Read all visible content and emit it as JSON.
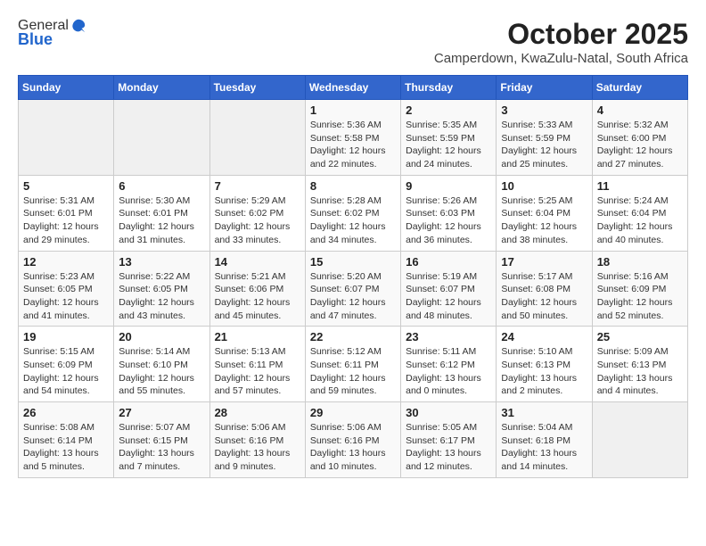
{
  "header": {
    "logo_line1": "General",
    "logo_line2": "Blue",
    "month_title": "October 2025",
    "subtitle": "Camperdown, KwaZulu-Natal, South Africa"
  },
  "days_of_week": [
    "Sunday",
    "Monday",
    "Tuesday",
    "Wednesday",
    "Thursday",
    "Friday",
    "Saturday"
  ],
  "weeks": [
    [
      {
        "day": "",
        "info": ""
      },
      {
        "day": "",
        "info": ""
      },
      {
        "day": "",
        "info": ""
      },
      {
        "day": "1",
        "info": "Sunrise: 5:36 AM\nSunset: 5:58 PM\nDaylight: 12 hours\nand 22 minutes."
      },
      {
        "day": "2",
        "info": "Sunrise: 5:35 AM\nSunset: 5:59 PM\nDaylight: 12 hours\nand 24 minutes."
      },
      {
        "day": "3",
        "info": "Sunrise: 5:33 AM\nSunset: 5:59 PM\nDaylight: 12 hours\nand 25 minutes."
      },
      {
        "day": "4",
        "info": "Sunrise: 5:32 AM\nSunset: 6:00 PM\nDaylight: 12 hours\nand 27 minutes."
      }
    ],
    [
      {
        "day": "5",
        "info": "Sunrise: 5:31 AM\nSunset: 6:01 PM\nDaylight: 12 hours\nand 29 minutes."
      },
      {
        "day": "6",
        "info": "Sunrise: 5:30 AM\nSunset: 6:01 PM\nDaylight: 12 hours\nand 31 minutes."
      },
      {
        "day": "7",
        "info": "Sunrise: 5:29 AM\nSunset: 6:02 PM\nDaylight: 12 hours\nand 33 minutes."
      },
      {
        "day": "8",
        "info": "Sunrise: 5:28 AM\nSunset: 6:02 PM\nDaylight: 12 hours\nand 34 minutes."
      },
      {
        "day": "9",
        "info": "Sunrise: 5:26 AM\nSunset: 6:03 PM\nDaylight: 12 hours\nand 36 minutes."
      },
      {
        "day": "10",
        "info": "Sunrise: 5:25 AM\nSunset: 6:04 PM\nDaylight: 12 hours\nand 38 minutes."
      },
      {
        "day": "11",
        "info": "Sunrise: 5:24 AM\nSunset: 6:04 PM\nDaylight: 12 hours\nand 40 minutes."
      }
    ],
    [
      {
        "day": "12",
        "info": "Sunrise: 5:23 AM\nSunset: 6:05 PM\nDaylight: 12 hours\nand 41 minutes."
      },
      {
        "day": "13",
        "info": "Sunrise: 5:22 AM\nSunset: 6:05 PM\nDaylight: 12 hours\nand 43 minutes."
      },
      {
        "day": "14",
        "info": "Sunrise: 5:21 AM\nSunset: 6:06 PM\nDaylight: 12 hours\nand 45 minutes."
      },
      {
        "day": "15",
        "info": "Sunrise: 5:20 AM\nSunset: 6:07 PM\nDaylight: 12 hours\nand 47 minutes."
      },
      {
        "day": "16",
        "info": "Sunrise: 5:19 AM\nSunset: 6:07 PM\nDaylight: 12 hours\nand 48 minutes."
      },
      {
        "day": "17",
        "info": "Sunrise: 5:17 AM\nSunset: 6:08 PM\nDaylight: 12 hours\nand 50 minutes."
      },
      {
        "day": "18",
        "info": "Sunrise: 5:16 AM\nSunset: 6:09 PM\nDaylight: 12 hours\nand 52 minutes."
      }
    ],
    [
      {
        "day": "19",
        "info": "Sunrise: 5:15 AM\nSunset: 6:09 PM\nDaylight: 12 hours\nand 54 minutes."
      },
      {
        "day": "20",
        "info": "Sunrise: 5:14 AM\nSunset: 6:10 PM\nDaylight: 12 hours\nand 55 minutes."
      },
      {
        "day": "21",
        "info": "Sunrise: 5:13 AM\nSunset: 6:11 PM\nDaylight: 12 hours\nand 57 minutes."
      },
      {
        "day": "22",
        "info": "Sunrise: 5:12 AM\nSunset: 6:11 PM\nDaylight: 12 hours\nand 59 minutes."
      },
      {
        "day": "23",
        "info": "Sunrise: 5:11 AM\nSunset: 6:12 PM\nDaylight: 13 hours\nand 0 minutes."
      },
      {
        "day": "24",
        "info": "Sunrise: 5:10 AM\nSunset: 6:13 PM\nDaylight: 13 hours\nand 2 minutes."
      },
      {
        "day": "25",
        "info": "Sunrise: 5:09 AM\nSunset: 6:13 PM\nDaylight: 13 hours\nand 4 minutes."
      }
    ],
    [
      {
        "day": "26",
        "info": "Sunrise: 5:08 AM\nSunset: 6:14 PM\nDaylight: 13 hours\nand 5 minutes."
      },
      {
        "day": "27",
        "info": "Sunrise: 5:07 AM\nSunset: 6:15 PM\nDaylight: 13 hours\nand 7 minutes."
      },
      {
        "day": "28",
        "info": "Sunrise: 5:06 AM\nSunset: 6:16 PM\nDaylight: 13 hours\nand 9 minutes."
      },
      {
        "day": "29",
        "info": "Sunrise: 5:06 AM\nSunset: 6:16 PM\nDaylight: 13 hours\nand 10 minutes."
      },
      {
        "day": "30",
        "info": "Sunrise: 5:05 AM\nSunset: 6:17 PM\nDaylight: 13 hours\nand 12 minutes."
      },
      {
        "day": "31",
        "info": "Sunrise: 5:04 AM\nSunset: 6:18 PM\nDaylight: 13 hours\nand 14 minutes."
      },
      {
        "day": "",
        "info": ""
      }
    ]
  ]
}
